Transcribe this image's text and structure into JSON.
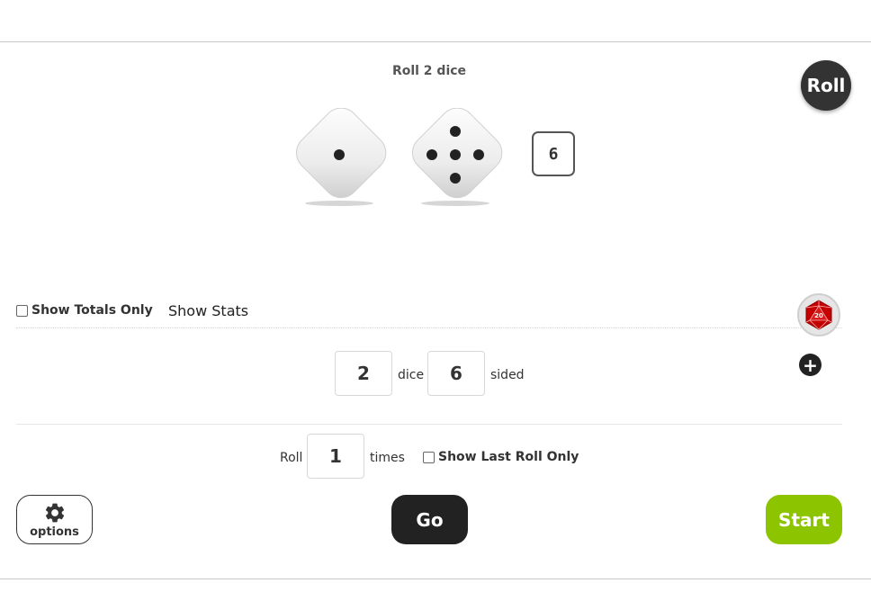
{
  "header": {
    "title": "Roll 2 dice"
  },
  "roll_button": {
    "label": "Roll"
  },
  "dice": [
    {
      "name": "die-1",
      "value": 1
    },
    {
      "name": "die-2",
      "value": 5
    }
  ],
  "total": {
    "value": "6"
  },
  "controls": {
    "show_totals_only": {
      "label": "Show Totals Only",
      "checked": false
    },
    "show_stats": {
      "label": "Show Stats"
    },
    "dice_count": {
      "value": "2",
      "suffix": "dice"
    },
    "sides": {
      "value": "6",
      "suffix": "sided"
    },
    "roll_times": {
      "prefix": "Roll",
      "value": "1",
      "suffix": "times"
    },
    "show_last_roll_only": {
      "label": "Show Last Roll Only",
      "checked": false
    },
    "d20_icon_text": "20"
  },
  "buttons": {
    "options": "options",
    "go": "Go",
    "start": "Start"
  },
  "colors": {
    "start_green": "#8dc400",
    "dark": "#222222",
    "d20_red": "#c40000"
  }
}
